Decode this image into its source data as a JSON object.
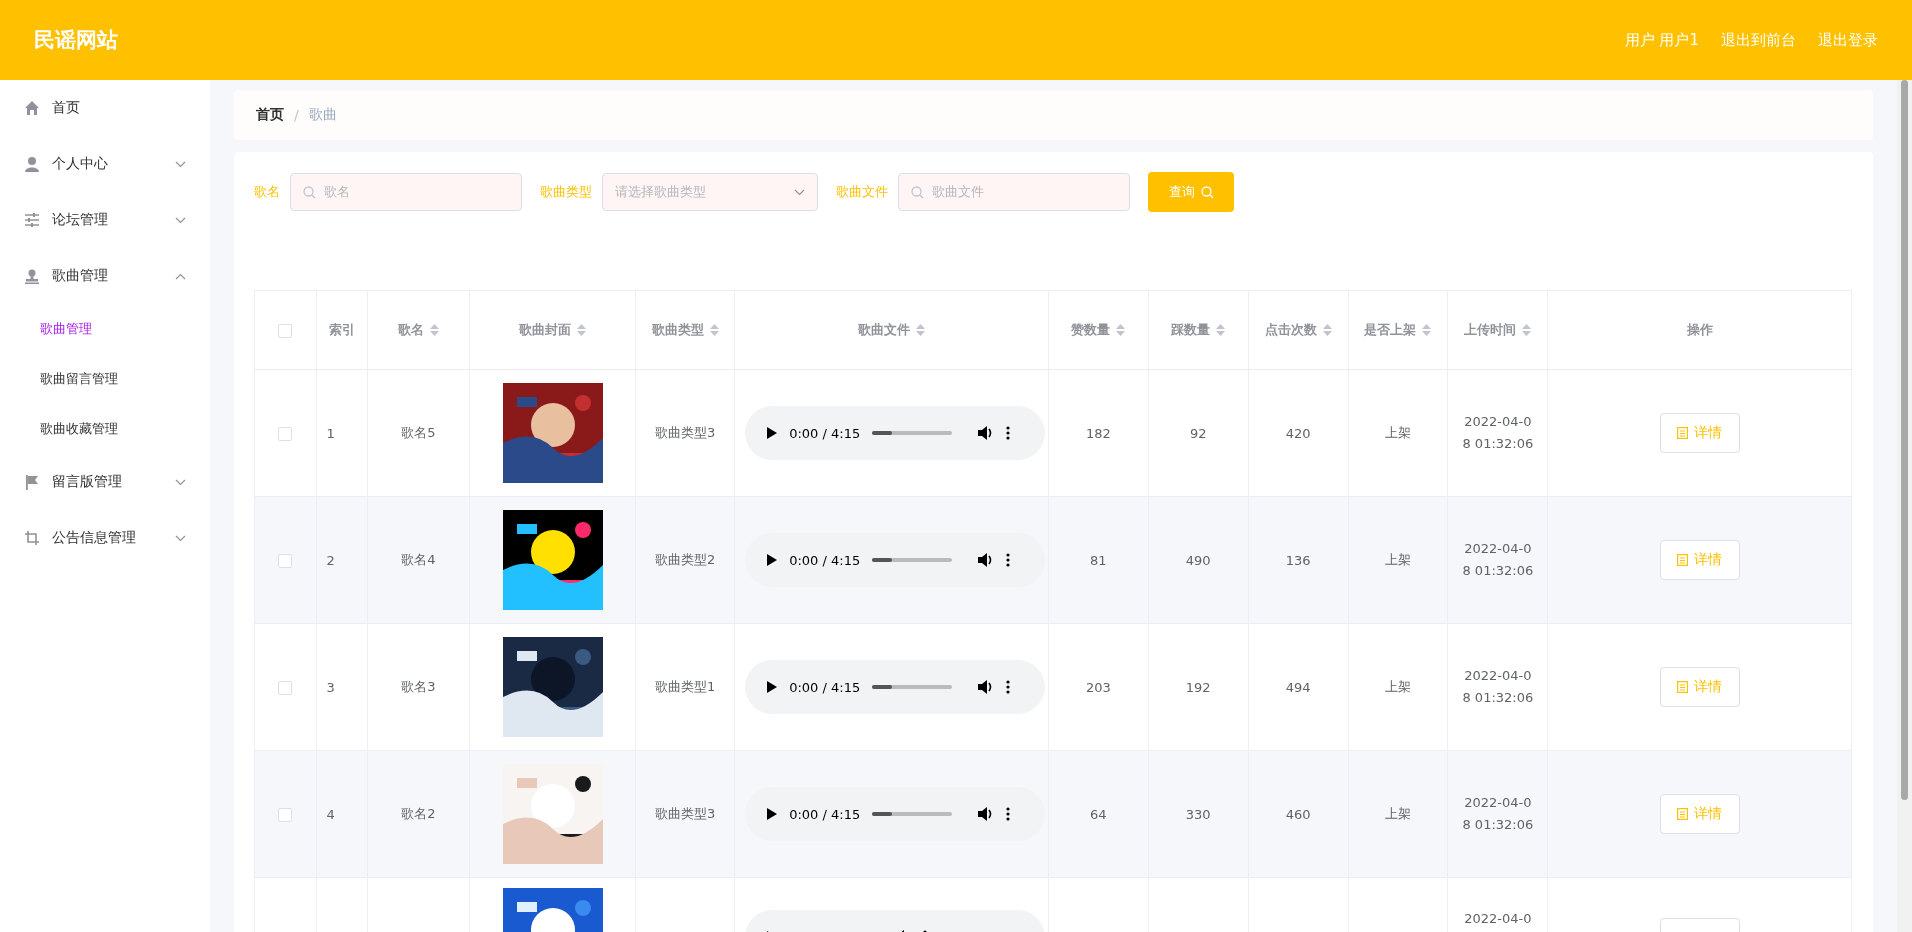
{
  "header": {
    "site_title": "民谣网站",
    "links": [
      "用户 用户1",
      "退出到前台",
      "退出登录"
    ]
  },
  "sidebar": {
    "items": [
      {
        "label": "首页"
      },
      {
        "label": "个人中心",
        "expanded": false
      },
      {
        "label": "论坛管理",
        "expanded": false
      },
      {
        "label": "歌曲管理",
        "expanded": true,
        "children": [
          {
            "label": "歌曲管理",
            "selected": true
          },
          {
            "label": "歌曲留言管理",
            "selected": false
          },
          {
            "label": "歌曲收藏管理",
            "selected": false
          }
        ]
      },
      {
        "label": "留言版管理",
        "expanded": false
      },
      {
        "label": "公告信息管理",
        "expanded": false
      }
    ]
  },
  "breadcrumb": {
    "items": [
      "首页",
      "歌曲"
    ],
    "separator": "/"
  },
  "search": {
    "fields": [
      {
        "kind": "text",
        "label": "歌名",
        "placeholder": "歌名"
      },
      {
        "kind": "select",
        "label": "歌曲类型",
        "placeholder": "请选择歌曲类型"
      },
      {
        "kind": "text",
        "label": "歌曲文件",
        "placeholder": "歌曲文件"
      }
    ],
    "button": "查询"
  },
  "table": {
    "select_all_checked": false,
    "columns": [
      {
        "label": "索引"
      },
      {
        "label": "歌名",
        "sortable": true
      },
      {
        "label": "歌曲封面",
        "sortable": true
      },
      {
        "label": "歌曲类型",
        "sortable": true
      },
      {
        "label": "歌曲文件",
        "sortable": true
      },
      {
        "label": "赞数量",
        "sortable": true
      },
      {
        "label": "踩数量",
        "sortable": true
      },
      {
        "label": "点击次数",
        "sortable": true
      },
      {
        "label": "是否上架",
        "sortable": true
      },
      {
        "label": "上传时间",
        "sortable": true
      },
      {
        "label": "操作"
      }
    ],
    "rows": [
      {
        "checked": false,
        "index": "1",
        "name": "歌名5",
        "type": "歌曲类型3",
        "audio_time": "0:00 / 4:15",
        "level": 0.25,
        "likes": "182",
        "dislikes": "92",
        "clicks": "420",
        "status": "上架",
        "time": "2022-04-08 01:32:06",
        "action": "详情"
      },
      {
        "checked": false,
        "index": "2",
        "name": "歌名4",
        "type": "歌曲类型2",
        "audio_time": "0:00 / 4:15",
        "level": 0.25,
        "likes": "81",
        "dislikes": "490",
        "clicks": "136",
        "status": "上架",
        "time": "2022-04-08 01:32:06",
        "action": "详情"
      },
      {
        "checked": false,
        "index": "3",
        "name": "歌名3",
        "type": "歌曲类型1",
        "audio_time": "0:00 / 4:15",
        "level": 0.25,
        "likes": "203",
        "dislikes": "192",
        "clicks": "494",
        "status": "上架",
        "time": "2022-04-08 01:32:06",
        "action": "详情"
      },
      {
        "checked": false,
        "index": "4",
        "name": "歌名2",
        "type": "歌曲类型3",
        "audio_time": "0:00 / 4:15",
        "level": 0.25,
        "likes": "64",
        "dislikes": "330",
        "clicks": "460",
        "status": "上架",
        "time": "2022-04-08 01:32:06",
        "action": "详情"
      },
      {
        "time": "2022-04-0"
      }
    ]
  }
}
